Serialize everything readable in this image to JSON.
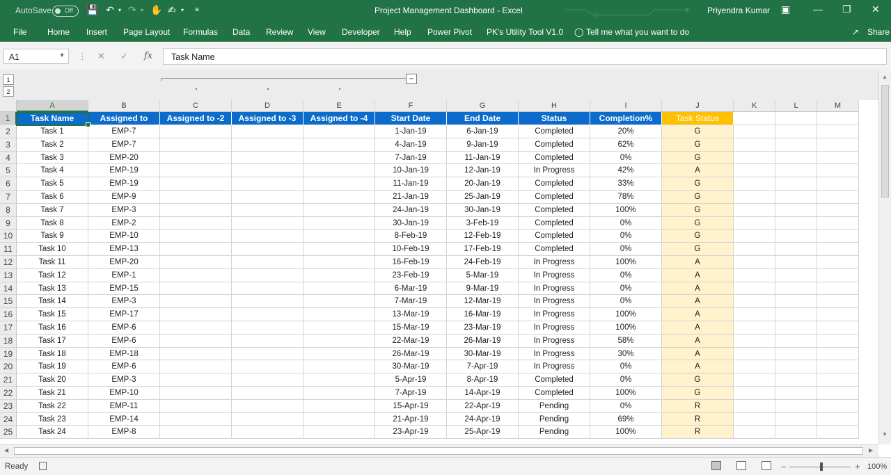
{
  "titlebar": {
    "autosave_label": "AutoSave",
    "autosave_state": "Off",
    "document_title": "Project Management Dashboard  -  Excel",
    "user_name": "Priyendra Kumar"
  },
  "ribbon": {
    "tabs": [
      "File",
      "Home",
      "Insert",
      "Page Layout",
      "Formulas",
      "Data",
      "Review",
      "View",
      "Developer",
      "Help",
      "Power Pivot",
      "PK's Utility Tool V1.0"
    ],
    "tell_me": "Tell me what you want to do",
    "share": "Share"
  },
  "formula_bar": {
    "name_box": "A1",
    "fx": "fx",
    "content": "Task Name"
  },
  "outline": {
    "levels": [
      "1",
      "2"
    ],
    "collapse": "−"
  },
  "sheet": {
    "column_letters": [
      "A",
      "B",
      "C",
      "D",
      "E",
      "F",
      "G",
      "H",
      "I",
      "J",
      "K",
      "L",
      "M"
    ],
    "headers": [
      "Task Name",
      "Assigned to",
      "Assigned to -2",
      "Assigned to -3",
      "Assigned to -4",
      "Start Date",
      "End Date",
      "Status",
      "Completion%",
      "Task Status"
    ],
    "rows": [
      [
        "Task 1",
        "EMP-7",
        "",
        "",
        "",
        "1-Jan-19",
        "6-Jan-19",
        "Completed",
        "20%",
        "G"
      ],
      [
        "Task 2",
        "EMP-7",
        "",
        "",
        "",
        "4-Jan-19",
        "9-Jan-19",
        "Completed",
        "62%",
        "G"
      ],
      [
        "Task 3",
        "EMP-20",
        "",
        "",
        "",
        "7-Jan-19",
        "11-Jan-19",
        "Completed",
        "0%",
        "G"
      ],
      [
        "Task 4",
        "EMP-19",
        "",
        "",
        "",
        "10-Jan-19",
        "12-Jan-19",
        "In Progress",
        "42%",
        "A"
      ],
      [
        "Task 5",
        "EMP-19",
        "",
        "",
        "",
        "11-Jan-19",
        "20-Jan-19",
        "Completed",
        "33%",
        "G"
      ],
      [
        "Task 6",
        "EMP-9",
        "",
        "",
        "",
        "21-Jan-19",
        "25-Jan-19",
        "Completed",
        "78%",
        "G"
      ],
      [
        "Task 7",
        "EMP-3",
        "",
        "",
        "",
        "24-Jan-19",
        "30-Jan-19",
        "Completed",
        "100%",
        "G"
      ],
      [
        "Task 8",
        "EMP-2",
        "",
        "",
        "",
        "30-Jan-19",
        "3-Feb-19",
        "Completed",
        "0%",
        "G"
      ],
      [
        "Task 9",
        "EMP-10",
        "",
        "",
        "",
        "8-Feb-19",
        "12-Feb-19",
        "Completed",
        "0%",
        "G"
      ],
      [
        "Task 10",
        "EMP-13",
        "",
        "",
        "",
        "10-Feb-19",
        "17-Feb-19",
        "Completed",
        "0%",
        "G"
      ],
      [
        "Task 11",
        "EMP-20",
        "",
        "",
        "",
        "16-Feb-19",
        "24-Feb-19",
        "In Progress",
        "100%",
        "A"
      ],
      [
        "Task 12",
        "EMP-1",
        "",
        "",
        "",
        "23-Feb-19",
        "5-Mar-19",
        "In Progress",
        "0%",
        "A"
      ],
      [
        "Task 13",
        "EMP-15",
        "",
        "",
        "",
        "6-Mar-19",
        "9-Mar-19",
        "In Progress",
        "0%",
        "A"
      ],
      [
        "Task 14",
        "EMP-3",
        "",
        "",
        "",
        "7-Mar-19",
        "12-Mar-19",
        "In Progress",
        "0%",
        "A"
      ],
      [
        "Task 15",
        "EMP-17",
        "",
        "",
        "",
        "13-Mar-19",
        "16-Mar-19",
        "In Progress",
        "100%",
        "A"
      ],
      [
        "Task 16",
        "EMP-6",
        "",
        "",
        "",
        "15-Mar-19",
        "23-Mar-19",
        "In Progress",
        "100%",
        "A"
      ],
      [
        "Task 17",
        "EMP-6",
        "",
        "",
        "",
        "22-Mar-19",
        "26-Mar-19",
        "In Progress",
        "58%",
        "A"
      ],
      [
        "Task 18",
        "EMP-18",
        "",
        "",
        "",
        "26-Mar-19",
        "30-Mar-19",
        "In Progress",
        "30%",
        "A"
      ],
      [
        "Task 19",
        "EMP-6",
        "",
        "",
        "",
        "30-Mar-19",
        "7-Apr-19",
        "In Progress",
        "0%",
        "A"
      ],
      [
        "Task 20",
        "EMP-3",
        "",
        "",
        "",
        "5-Apr-19",
        "8-Apr-19",
        "Completed",
        "0%",
        "G"
      ],
      [
        "Task 21",
        "EMP-10",
        "",
        "",
        "",
        "7-Apr-19",
        "14-Apr-19",
        "Completed",
        "100%",
        "G"
      ],
      [
        "Task 22",
        "EMP-11",
        "",
        "",
        "",
        "15-Apr-19",
        "22-Apr-19",
        "Pending",
        "0%",
        "R"
      ],
      [
        "Task 23",
        "EMP-14",
        "",
        "",
        "",
        "21-Apr-19",
        "24-Apr-19",
        "Pending",
        "69%",
        "R"
      ],
      [
        "Task 24",
        "EMP-8",
        "",
        "",
        "",
        "23-Apr-19",
        "25-Apr-19",
        "Pending",
        "100%",
        "R"
      ]
    ]
  },
  "statusbar": {
    "ready": "Ready",
    "zoom": "100%"
  },
  "colors": {
    "excel_green": "#217346",
    "header_blue": "#0b6ccb",
    "status_header": "#ffc000",
    "status_fill": "#fff2cc"
  }
}
